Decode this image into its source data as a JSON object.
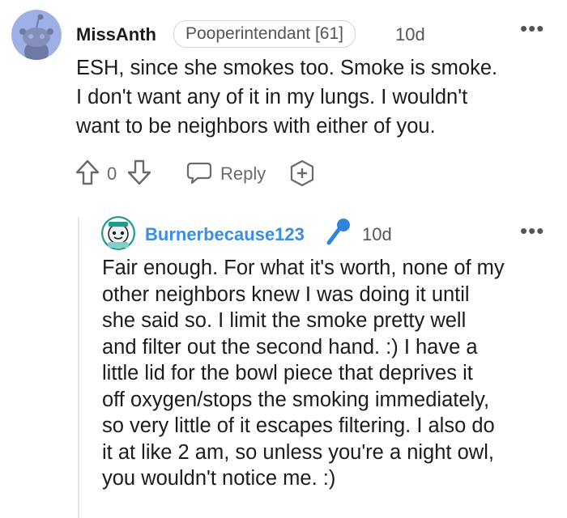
{
  "comment": {
    "username": "MissAnth",
    "flair": "Pooperintendant [61]",
    "time": "10d",
    "more_icon": "more-dots-icon",
    "body": [
      "ESH, since she smokes too. Smoke is smoke.",
      "I don't want any of it in my lungs. I wouldn't",
      "want to be neighbors with either of you."
    ],
    "score": "0",
    "reply_label": "Reply",
    "award_icon": "plus-award-icon"
  },
  "reply": {
    "username": "Burnerbecause123",
    "username_color": "#3b8ee0",
    "time": "10d",
    "badge_icon": "microphone-icon",
    "body": [
      "Fair enough. For what it's worth, none of my",
      "other neighbors knew I was doing it until",
      "she said so. I limit the smoke pretty well",
      "and filter out the second hand. :) I have a",
      "little lid for the bowl piece that deprives it",
      "off oxygen/stops the smoking immediately,",
      "so very little of it escapes filtering. I also do",
      "it at like 2 am, so unless you're a night owl,",
      "you wouldn't notice me. :)"
    ]
  }
}
